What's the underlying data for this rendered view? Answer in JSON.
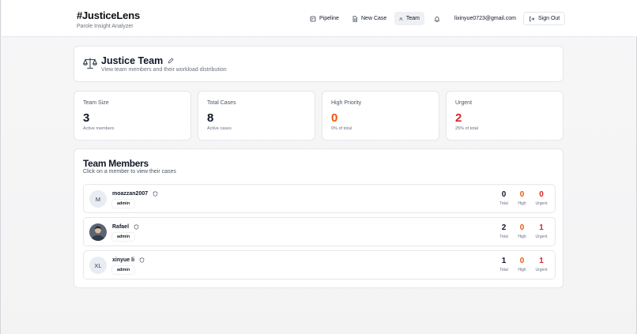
{
  "app": {
    "title": "#JusticeLens",
    "subtitle": "Parole Insight Analyzer"
  },
  "nav": {
    "pipeline": "Pipeline",
    "new_case": "New Case",
    "team": "Team",
    "email": "lixinyue0723@gmail.com",
    "sign_out": "Sign Out"
  },
  "hero": {
    "title": "Justice Team",
    "subtitle": "View team members and their workload distribution"
  },
  "stats": [
    {
      "label": "Team Size",
      "value": "3",
      "note": "Active members"
    },
    {
      "label": "Total Cases",
      "value": "8",
      "note": "Active cases"
    },
    {
      "label": "High Priority",
      "value": "0",
      "note": "0% of total"
    },
    {
      "label": "Urgent",
      "value": "2",
      "note": "25% of total"
    }
  ],
  "members_section": {
    "title": "Team Members",
    "subtitle": "Click on a member to view their cases",
    "count_labels": {
      "total": "Total",
      "high": "High",
      "urgent": "Urgent"
    }
  },
  "members": [
    {
      "initials": "M",
      "name": "moazzan2007",
      "role": "admin",
      "total": "0",
      "high": "0",
      "urgent": "0"
    },
    {
      "initials": "",
      "name": "Rafael",
      "role": "admin",
      "total": "2",
      "high": "0",
      "urgent": "1"
    },
    {
      "initials": "XL",
      "name": "xinyue li",
      "role": "admin",
      "total": "1",
      "high": "0",
      "urgent": "1"
    }
  ],
  "colors": {
    "accent_orange": "#ea580c",
    "accent_red": "#dc2626",
    "active_nav_bg": "#eef0f3"
  },
  "icons": {
    "pipeline": "kanban-icon",
    "new_case": "file-icon",
    "team": "users-icon",
    "bell": "bell-icon",
    "sign_out": "logout-icon",
    "hero": "scales-icon",
    "edit": "pencil-icon",
    "role": "shield-icon"
  }
}
